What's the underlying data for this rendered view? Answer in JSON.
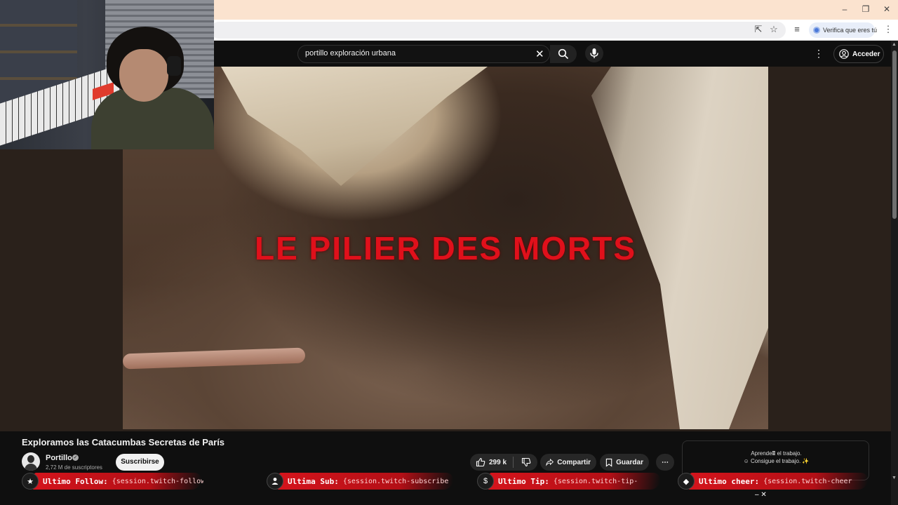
{
  "browser": {
    "verify_label": "Verifica que eres tú"
  },
  "youtube": {
    "search_value": "portillo exploración urbana",
    "signin_label": "Acceder"
  },
  "player": {
    "overlay_title": "LE PILIER DES MORTS"
  },
  "video": {
    "title": "Exploramos las Catacumbas Secretas de París",
    "channel": "Portillo",
    "subscribers": "2,72 M de suscriptores",
    "subscribe_label": "Suscribirse",
    "likes": "299 k",
    "share_label": "Compartir",
    "save_label": "Guardar"
  },
  "ad": {
    "line1": "Aprende🖩 el trabajo.",
    "line2": "☺ Consigue el trabajo. ✨"
  },
  "alerts": [
    {
      "label": "Ultimo Follow:",
      "value": "{session.twitch-follower",
      "icon": "star-icon"
    },
    {
      "label": "Ultima Sub:",
      "value": "{session.twitch-subscriber",
      "icon": "person-icon"
    },
    {
      "label": "Ultimo Tip:",
      "value": "{session.twitch-tip-",
      "icon": "coin-icon"
    },
    {
      "label": "Ultimo cheer:",
      "value": "{session.twitch-cheer",
      "icon": "gem-icon"
    }
  ],
  "colors": {
    "overlay_red": "#e0101b",
    "alert_red": "#d4141c",
    "titlebar": "#fbe3cf"
  }
}
